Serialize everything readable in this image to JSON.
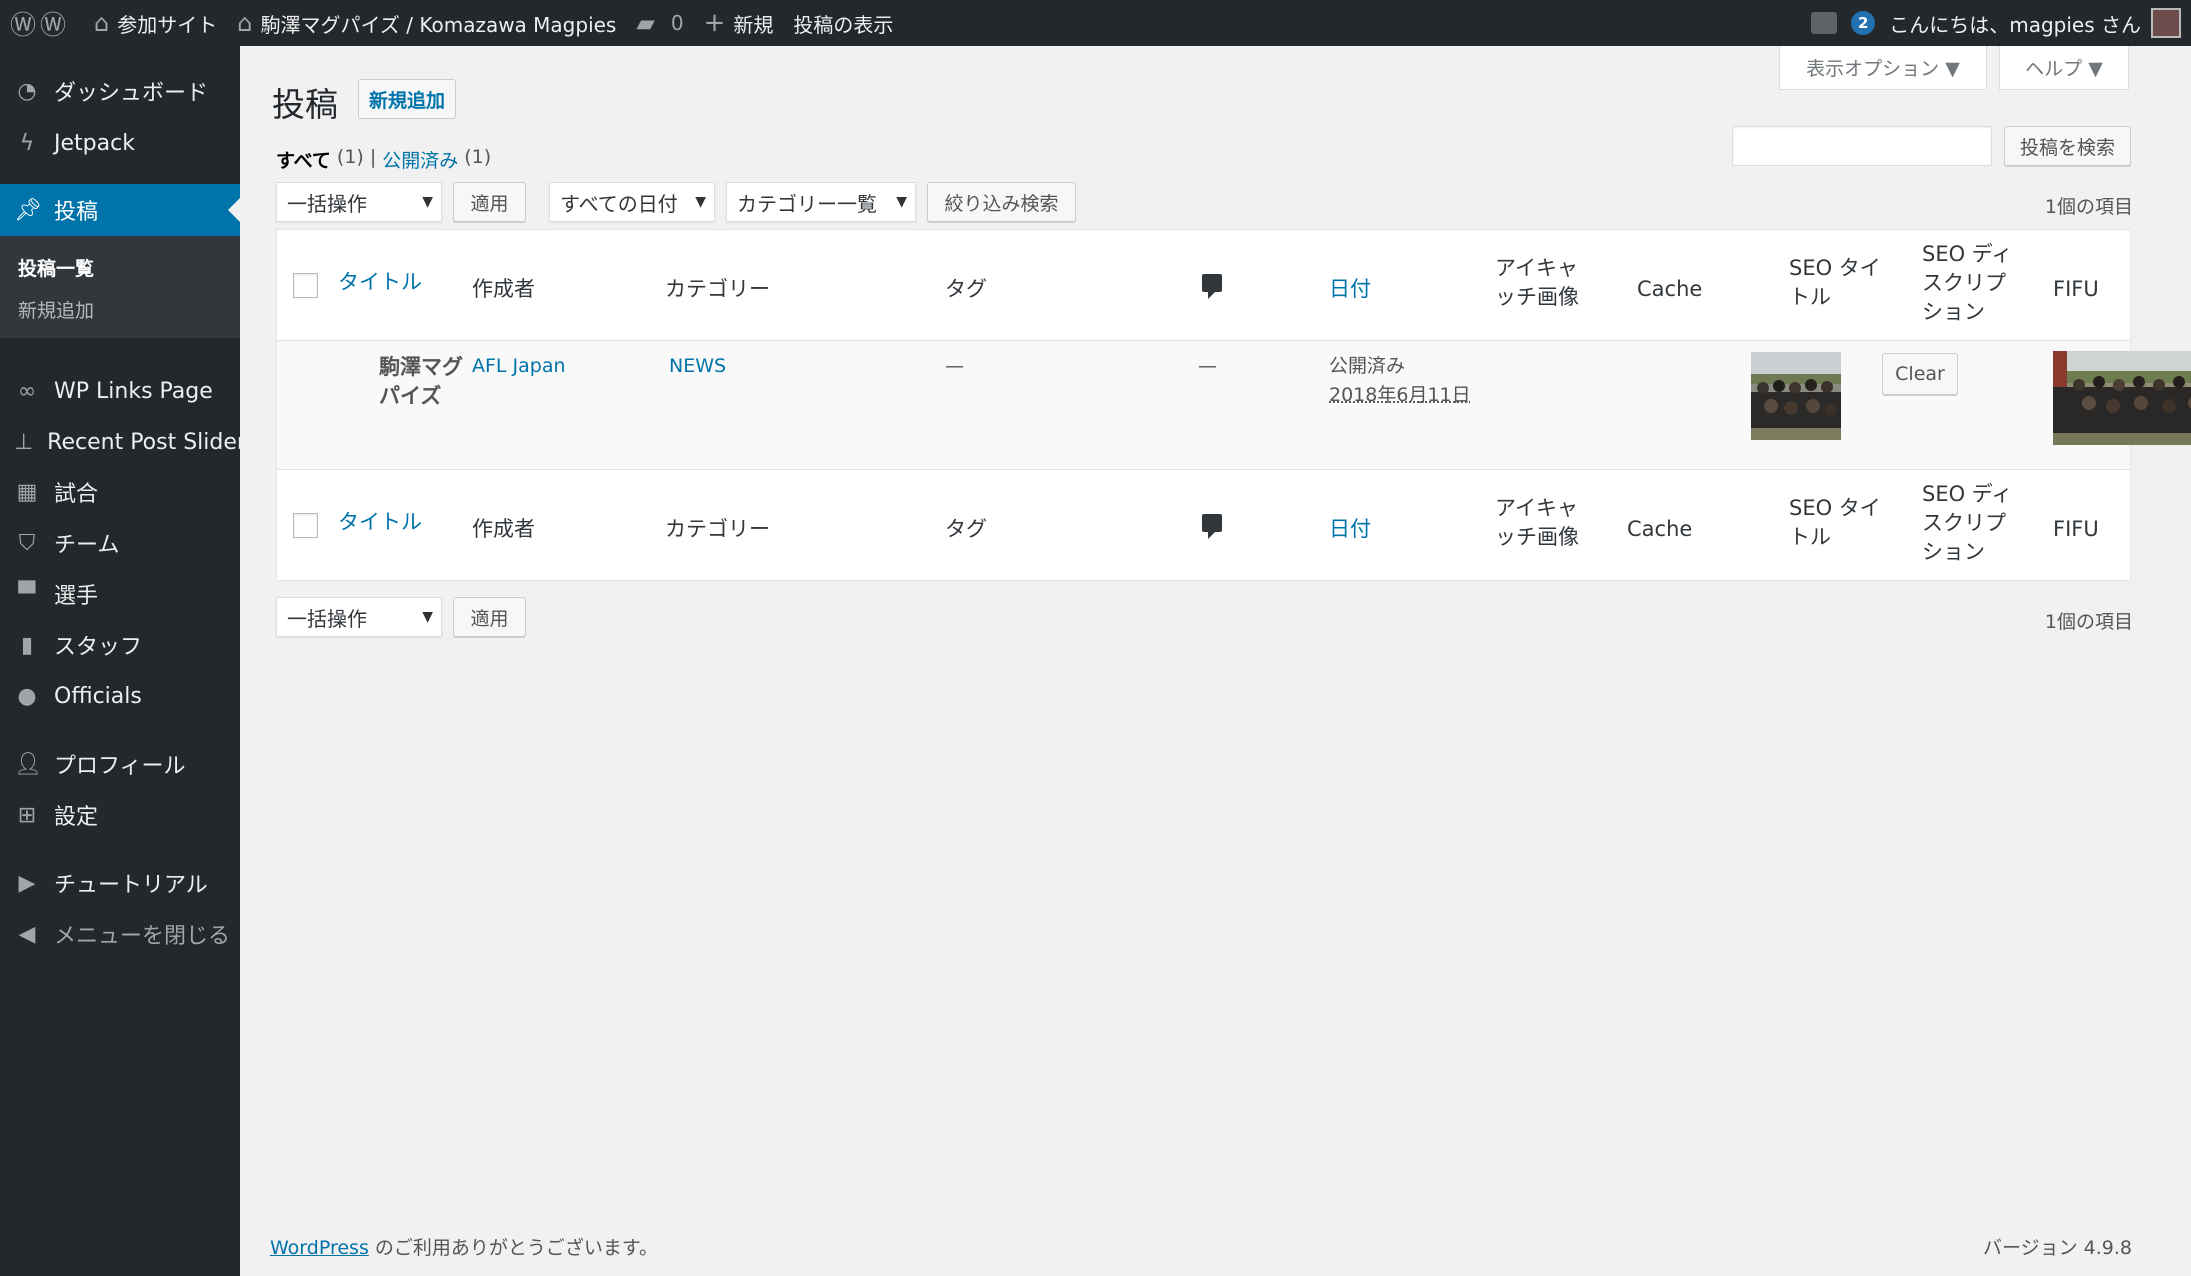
{
  "adminbar": {
    "site_name": "参加サイト",
    "site_title": "駒澤マグパイズ / Komazawa Magpies",
    "comments_count": "0",
    "new_label": "新規",
    "view_posts": "投稿の表示",
    "notifications": "2",
    "greeting": "こんにちは、magpies さん"
  },
  "sidebar": {
    "items": [
      {
        "label": "ダッシュボード",
        "icon": "dashboard-icon"
      },
      {
        "label": "Jetpack",
        "icon": "jetpack-icon"
      },
      {
        "label": "投稿",
        "icon": "pin-icon"
      },
      {
        "label": "WP Links Page",
        "icon": "link-icon"
      },
      {
        "label": "Recent Post Slider",
        "icon": "thumbtack-icon"
      },
      {
        "label": "試合",
        "icon": "calendar-icon"
      },
      {
        "label": "チーム",
        "icon": "shield-icon"
      },
      {
        "label": "選手",
        "icon": "shirt-icon"
      },
      {
        "label": "スタッフ",
        "icon": "tie-icon"
      },
      {
        "label": "Officials",
        "icon": "whistle-icon"
      },
      {
        "label": "プロフィール",
        "icon": "user-icon"
      },
      {
        "label": "設定",
        "icon": "settings-icon"
      },
      {
        "label": "チュートリアル",
        "icon": "video-icon"
      },
      {
        "label": "メニューを閉じる",
        "icon": "collapse-icon"
      }
    ],
    "submenu": [
      "投稿一覧",
      "新規追加"
    ]
  },
  "screen_options": "表示オプション ▼",
  "help": "ヘルプ ▼",
  "page": {
    "title": "投稿",
    "add_new": "新規追加"
  },
  "filters": {
    "all": "すべて",
    "all_count": "(1)",
    "sep": "|",
    "published": "公開済み",
    "published_count": "(1)"
  },
  "search_button": "投稿を検索",
  "bulk_action": "一括操作",
  "apply": "適用",
  "date_filter": "すべての日付",
  "category_filter": "カテゴリー一覧",
  "filter_button": "絞り込み検索",
  "items_count": "1個の項目",
  "columns": {
    "title": "タイトル",
    "author": "作成者",
    "categories": "カテゴリー",
    "tags": "タグ",
    "date": "日付",
    "featured_1": "アイキャ",
    "featured_2": "ッチ画像",
    "cache": "Cache",
    "seo_title_1": "SEO タイ",
    "seo_title_2": "トル",
    "seo_desc_1": "SEO ディ",
    "seo_desc_2": "スクリプ",
    "seo_desc_3": "ション",
    "fifu": "FIFU"
  },
  "post": {
    "title_1": "駒澤マグ",
    "title_2": "パイズ",
    "author": "AFL Japan",
    "category": "NEWS",
    "tags": "—",
    "comments": "—",
    "status": "公開済み",
    "date": "2018年6月11日",
    "cache_button": "Clear"
  },
  "footer": {
    "wordpress": "WordPress",
    "thanks": " のご利用ありがとうございます。",
    "version": "バージョン 4.9.8"
  },
  "colors": {
    "adminbar": "#23282d",
    "accent": "#0073aa",
    "background": "#f1f1f1"
  }
}
